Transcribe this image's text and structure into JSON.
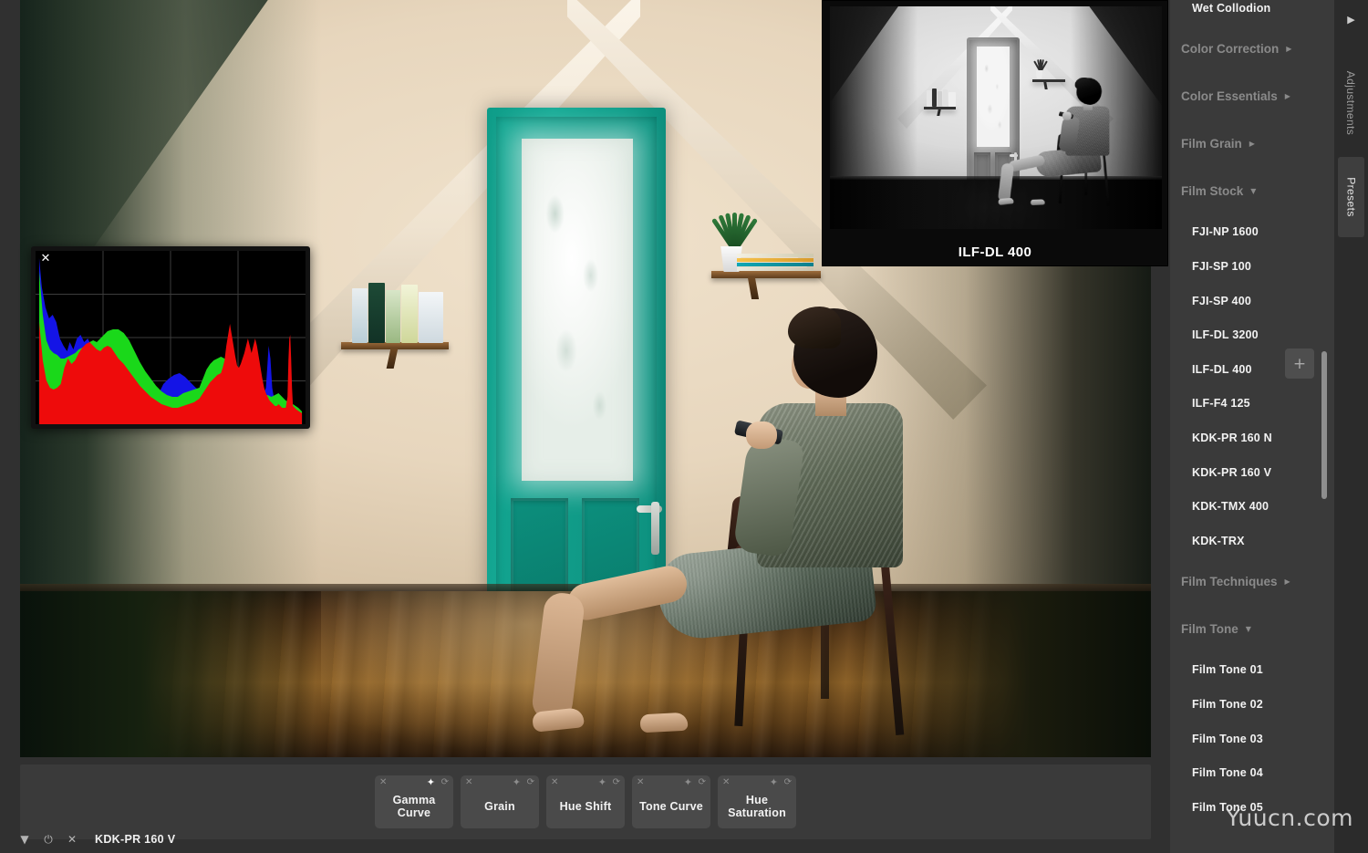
{
  "app": {
    "status_preset_name": "KDK-PR 160 V"
  },
  "histogram": {
    "close_icon": "✕",
    "channels": [
      "red",
      "green",
      "blue"
    ],
    "grid_cols": 4,
    "grid_rows": 4
  },
  "preview": {
    "label": "ILF-DL 400"
  },
  "filter_bar": {
    "buttons": [
      {
        "label": "Gamma\nCurve",
        "close_icon": "✕",
        "pin_icon": "✦",
        "reset_icon": "⟳",
        "pinned": true
      },
      {
        "label": "Grain",
        "close_icon": "✕",
        "pin_icon": "✦",
        "reset_icon": "⟳",
        "pinned": false
      },
      {
        "label": "Hue Shift",
        "close_icon": "✕",
        "pin_icon": "✦",
        "reset_icon": "⟳",
        "pinned": false
      },
      {
        "label": "Tone Curve",
        "close_icon": "✕",
        "pin_icon": "✦",
        "reset_icon": "⟳",
        "pinned": false
      },
      {
        "label": "Hue\nSaturation",
        "close_icon": "✕",
        "pin_icon": "✦",
        "reset_icon": "⟳",
        "pinned": false
      }
    ]
  },
  "status_bar": {
    "expand_icon": "▼",
    "power_icon": "⏻",
    "close_icon": "✕",
    "preset_name": "KDK-PR 160 V"
  },
  "sidebar": {
    "add_button_label": "+",
    "entries": [
      {
        "type": "preset",
        "label": "Wet Collodion"
      },
      {
        "type": "section",
        "label": "Color Correction",
        "arrow": "▶",
        "expanded": false
      },
      {
        "type": "section",
        "label": "Color Essentials",
        "arrow": "▶",
        "expanded": false
      },
      {
        "type": "section",
        "label": "Film Grain",
        "arrow": "▶",
        "expanded": false
      },
      {
        "type": "section",
        "label": "Film Stock",
        "arrow": "▼",
        "expanded": true
      },
      {
        "type": "preset",
        "label": "FJI-NP 1600"
      },
      {
        "type": "preset",
        "label": "FJI-SP 100"
      },
      {
        "type": "preset",
        "label": "FJI-SP 400"
      },
      {
        "type": "preset",
        "label": "ILF-DL 3200"
      },
      {
        "type": "preset",
        "label": "ILF-DL 400"
      },
      {
        "type": "preset",
        "label": "ILF-F4 125"
      },
      {
        "type": "preset",
        "label": "KDK-PR 160 N"
      },
      {
        "type": "preset",
        "label": "KDK-PR 160 V"
      },
      {
        "type": "preset",
        "label": "KDK-TMX 400"
      },
      {
        "type": "preset",
        "label": "KDK-TRX"
      },
      {
        "type": "section",
        "label": "Film Techniques",
        "arrow": "▶",
        "expanded": false
      },
      {
        "type": "section",
        "label": "Film Tone",
        "arrow": "▼",
        "expanded": true
      },
      {
        "type": "preset",
        "label": "Film Tone 01"
      },
      {
        "type": "preset",
        "label": "Film Tone 02"
      },
      {
        "type": "preset",
        "label": "Film Tone 03"
      },
      {
        "type": "preset",
        "label": "Film Tone 04"
      },
      {
        "type": "preset",
        "label": "Film Tone 05"
      }
    ]
  },
  "tab_rail": {
    "collapse_icon": "▶",
    "tabs": [
      {
        "label": "Adjustments",
        "active": false
      },
      {
        "label": "Presets",
        "active": true
      }
    ]
  },
  "watermark": {
    "text": "Yuucn.com"
  },
  "colors": {
    "panel_bg": "#3a3a3a",
    "app_bg": "#2b2b2b",
    "accent_teal": "#10a08c",
    "text_bright": "#f2f2f2",
    "text_dim": "#8a8a8a",
    "hist_red": "#ee0b0b",
    "hist_green": "#1ad81a",
    "hist_blue": "#1414e6"
  }
}
